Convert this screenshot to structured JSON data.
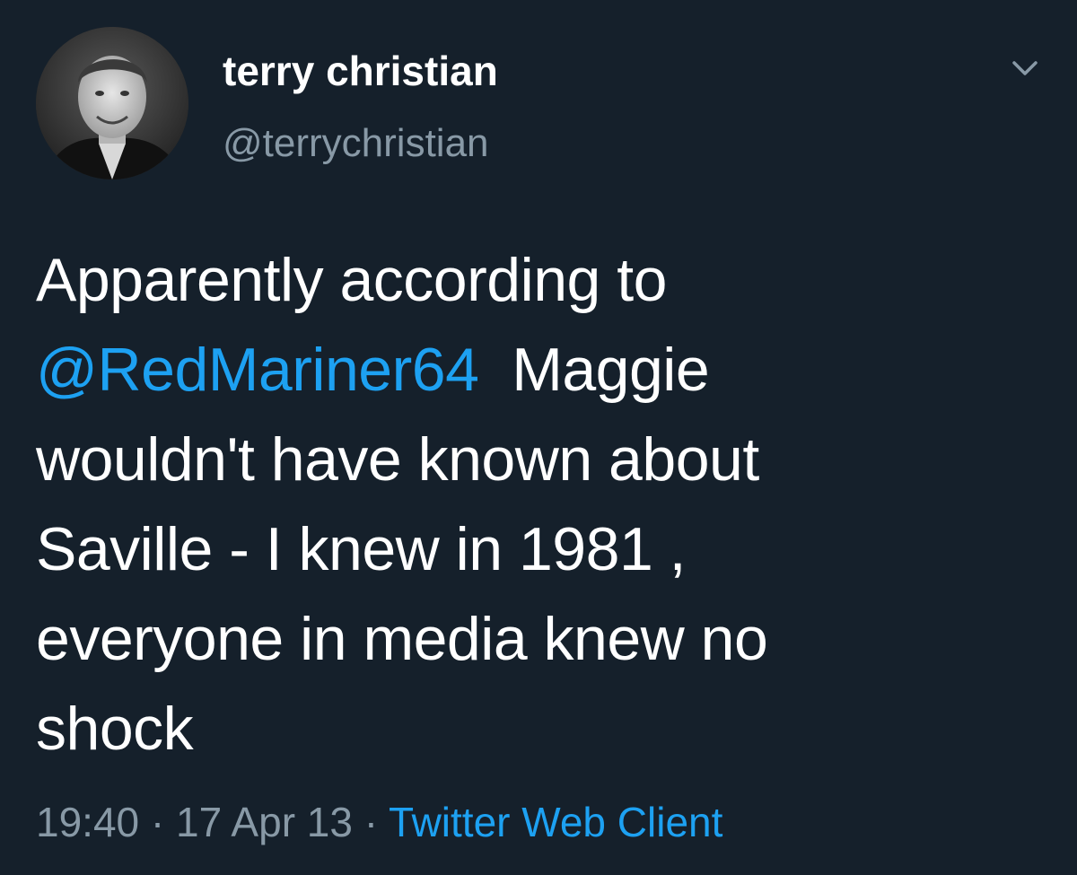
{
  "colors": {
    "background": "#15202b",
    "text": "#ffffff",
    "muted": "#8899a6",
    "link": "#1da1f2"
  },
  "tweet": {
    "author": {
      "display_name": "terry christian",
      "handle": "@terrychristian",
      "avatar_icon": "profile-photo"
    },
    "menu_icon": "chevron-down-icon",
    "text_lines": [
      {
        "prefix": "Apparently according to",
        "mention": "",
        "suffix": ""
      },
      {
        "prefix": "",
        "mention": "@RedMariner64",
        "suffix": "  Maggie"
      },
      {
        "prefix": "wouldn't have known about",
        "mention": "",
        "suffix": ""
      },
      {
        "prefix": "Saville - I knew in 1981 ,",
        "mention": "",
        "suffix": ""
      },
      {
        "prefix": "everyone in media knew no",
        "mention": "",
        "suffix": ""
      },
      {
        "prefix": "shock",
        "mention": "",
        "suffix": ""
      }
    ],
    "time": "19:40",
    "separator": " · ",
    "date": "17 Apr 13",
    "source": "Twitter Web Client"
  }
}
